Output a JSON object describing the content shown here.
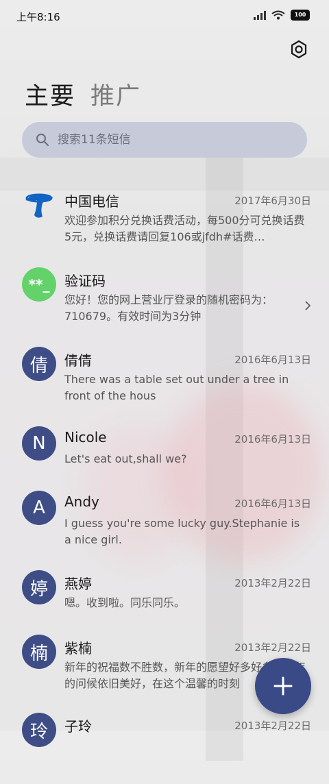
{
  "status_bar": {
    "time": "上午8:16",
    "battery": "100"
  },
  "tabs": [
    {
      "label": "主要"
    },
    {
      "label": "推广"
    }
  ],
  "search": {
    "placeholder": "搜索11条短信"
  },
  "conversations": [
    {
      "avatar": "",
      "name": "中国电信",
      "date": "2017年6月30日",
      "preview": "欢迎参加积分兑换话费活动，每500分可兑换话费5元，兑换话费请回复106或jfdh#话费…"
    },
    {
      "avatar": "**_",
      "name": "验证码",
      "date": "",
      "preview": "您好！您的网上营业厅登录的随机密码为：710679。有效时间为3分钟"
    },
    {
      "avatar": "倩",
      "name": "倩倩",
      "date": "2016年6月13日",
      "preview": "There was a table set out under a tree in front of the hous"
    },
    {
      "avatar": "N",
      "name": "Nicole",
      "date": "2016年6月13日",
      "preview": "Let's eat out,shall we?"
    },
    {
      "avatar": "A",
      "name": "Andy",
      "date": "2016年6月13日",
      "preview": "I guess you're some lucky guy.Stephanie is a nice girl."
    },
    {
      "avatar": "婷",
      "name": "燕婷",
      "date": "2013年2月22日",
      "preview": "嗯。收到啦。同乐同乐。"
    },
    {
      "avatar": "楠",
      "name": "紫楠",
      "date": "2013年2月22日",
      "preview": "新年的祝福数不胜数，新年的愿望好多好多，新年的问候依旧美好，在这个温馨的时刻"
    },
    {
      "avatar": "玲",
      "name": "子玲",
      "date": "2013年2月22日",
      "preview": ""
    }
  ],
  "colors": {
    "avatar": "#3e4d86",
    "verify_avatar": "#64d26a",
    "fab": "#3a4a87",
    "search_bg": "#c7cad9"
  },
  "icons": {
    "settings": "settings-gear-icon",
    "search": "search-icon",
    "compose": "plus-icon",
    "chevron": "chevron-right-icon"
  }
}
